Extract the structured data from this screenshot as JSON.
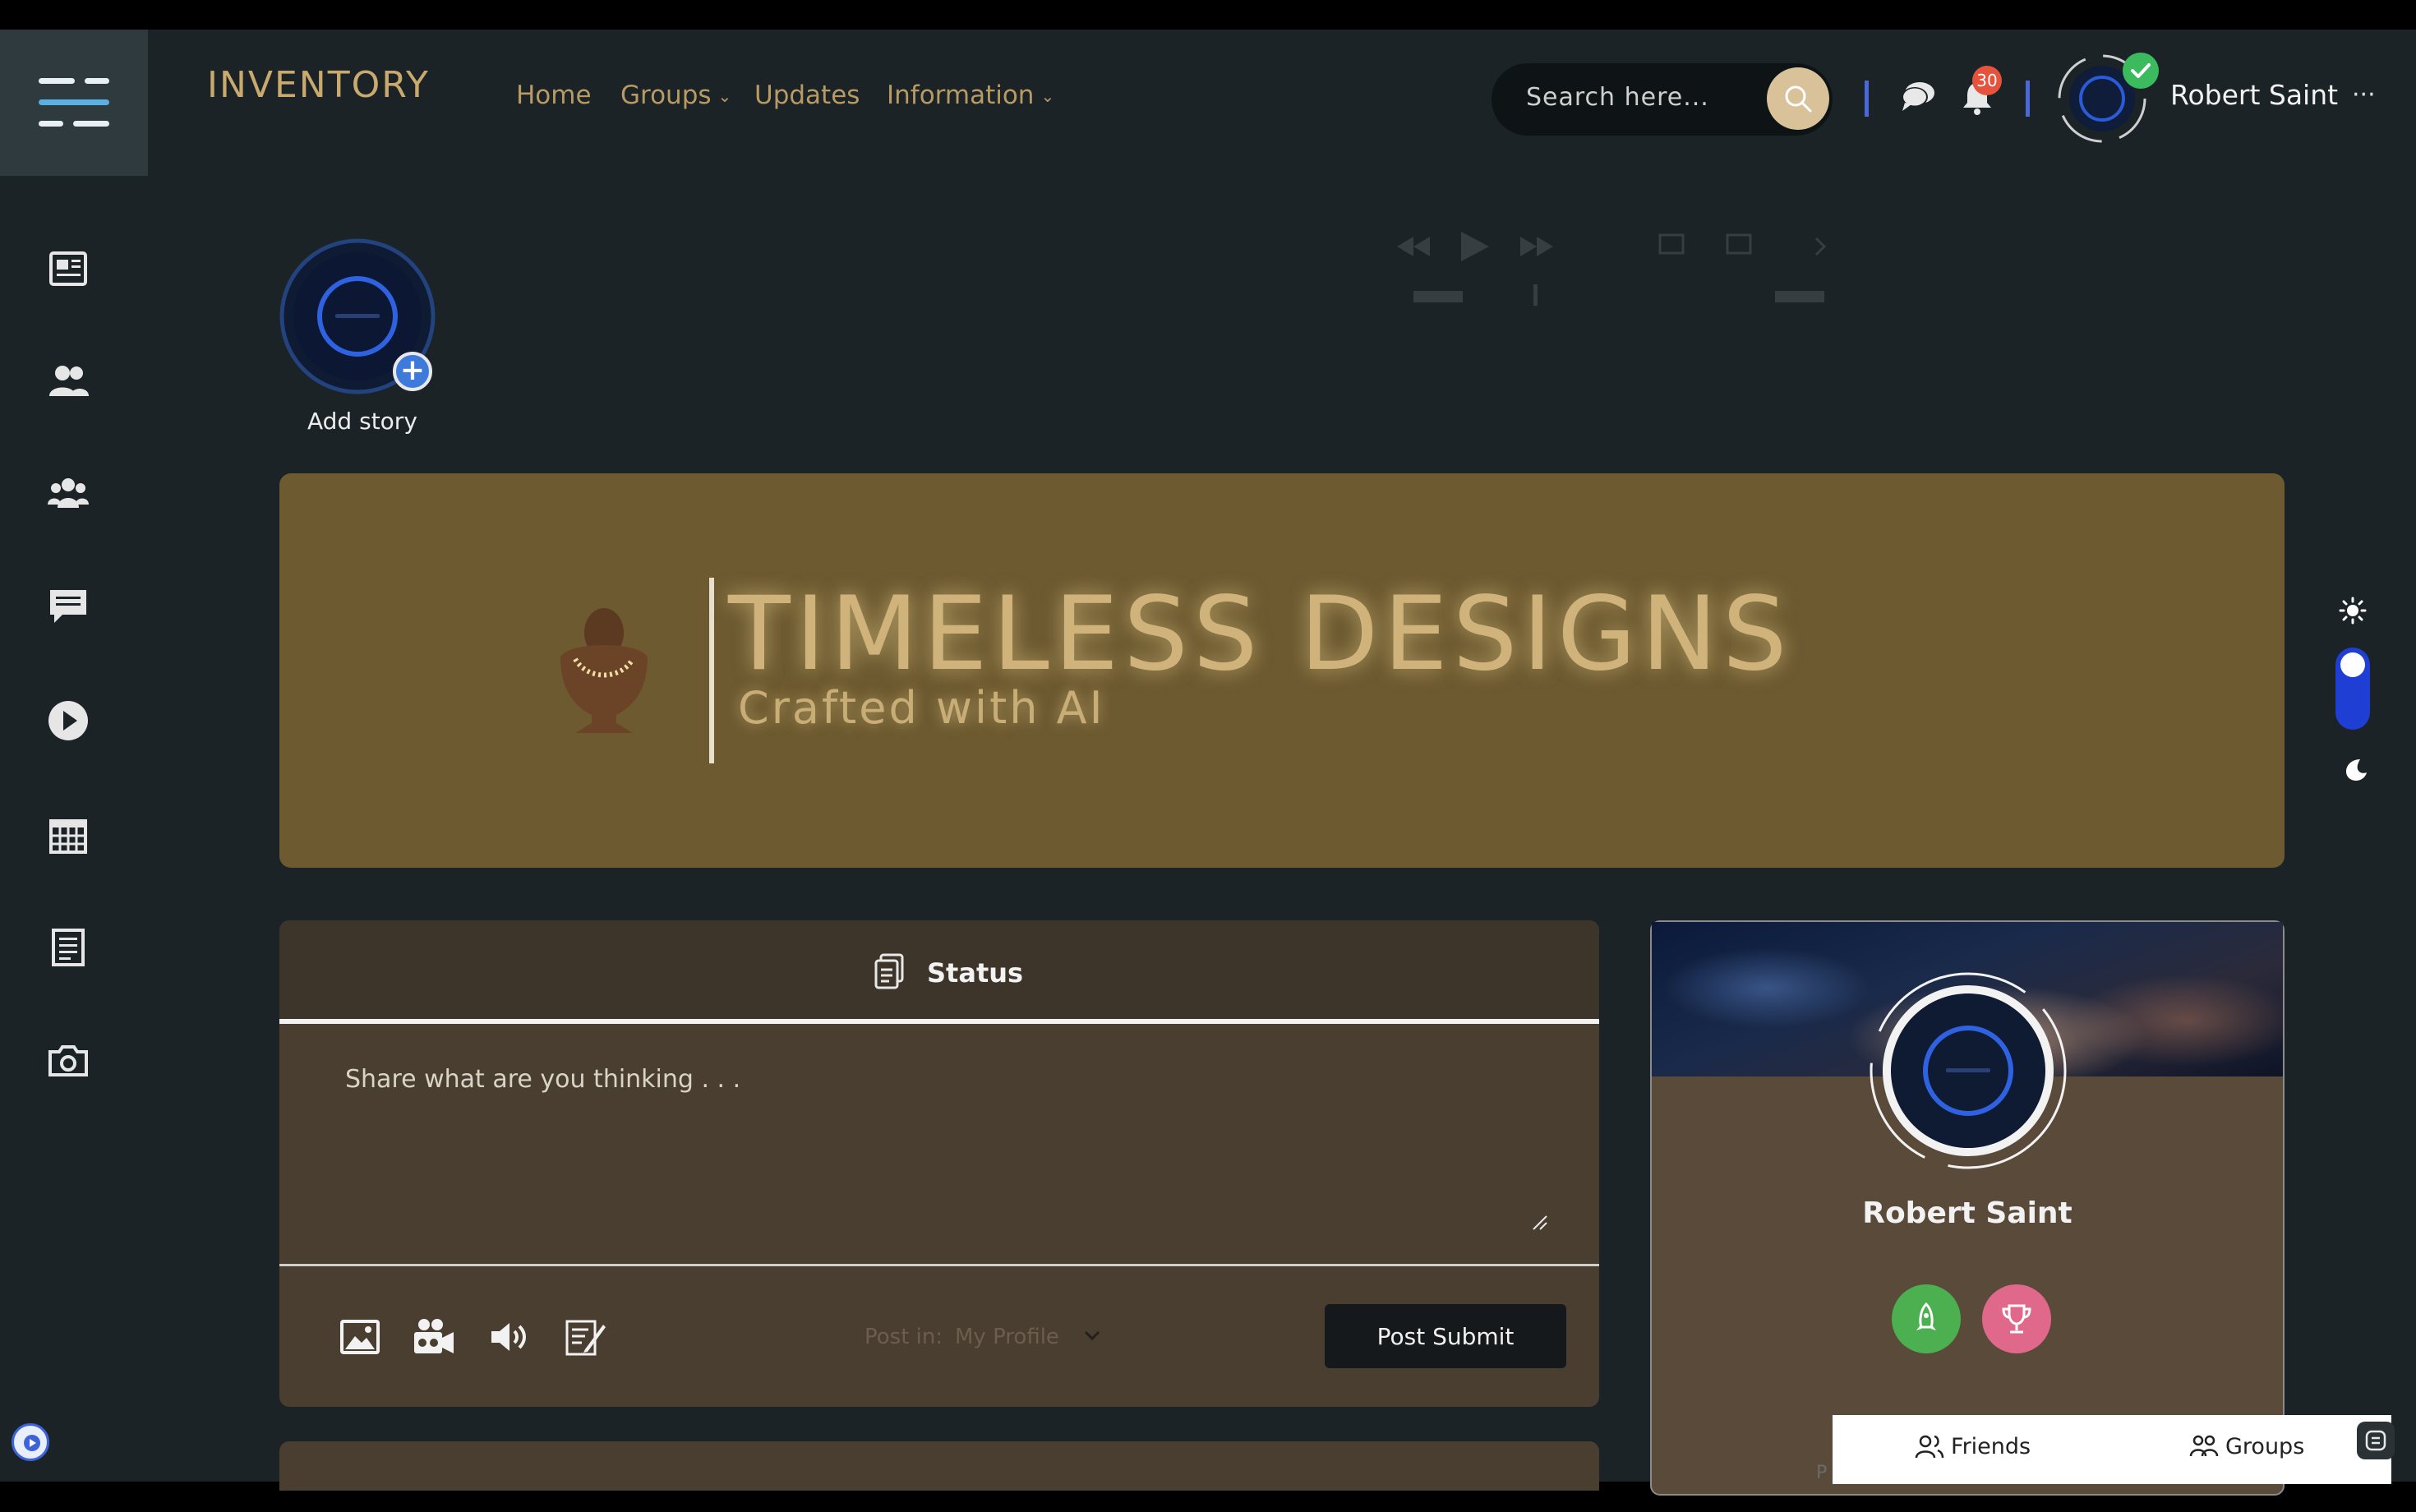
{
  "header": {
    "brand": "INVENTORY",
    "nav": [
      {
        "label": "Home",
        "has_dropdown": false
      },
      {
        "label": "Groups",
        "has_dropdown": true
      },
      {
        "label": "Updates",
        "has_dropdown": false
      },
      {
        "label": "Information",
        "has_dropdown": true
      }
    ],
    "search": {
      "placeholder": "Search here..."
    },
    "notifications_count": "30",
    "user_name": "Robert Saint",
    "more_label": "···"
  },
  "sidebar": {
    "icons": [
      "newspaper-icon",
      "friends-icon",
      "groups-icon",
      "messages-icon",
      "videos-icon",
      "calendar-icon",
      "notes-icon",
      "photos-icon"
    ]
  },
  "stories": {
    "add_label": "Add story",
    "add_symbol": "+"
  },
  "banner": {
    "title": "TIMELESS DESIGNS",
    "subtitle": "Crafted with AI"
  },
  "theme_switch": {
    "mode": "dark"
  },
  "status": {
    "title": "Status",
    "placeholder": "Share what are you thinking . . .",
    "tools": [
      "image-icon",
      "video-icon",
      "audio-icon",
      "write-icon"
    ],
    "post_in_label": "Post in:",
    "post_in_value": "My Profile",
    "submit_label": "Post Submit"
  },
  "profile": {
    "name": "Robert Saint",
    "badges": [
      "rocket-badge",
      "trophy-badge"
    ]
  },
  "bottom_tabs": {
    "friends_label": "Friends",
    "groups_label": "Groups",
    "fragment": "P"
  },
  "colors": {
    "background": "#1b2327",
    "brand_gold": "#c9a96e",
    "banner": "#6d5a30",
    "card": "#4a3e30",
    "accent_blue": "#1f3fd4",
    "notification": "#e5533d"
  }
}
